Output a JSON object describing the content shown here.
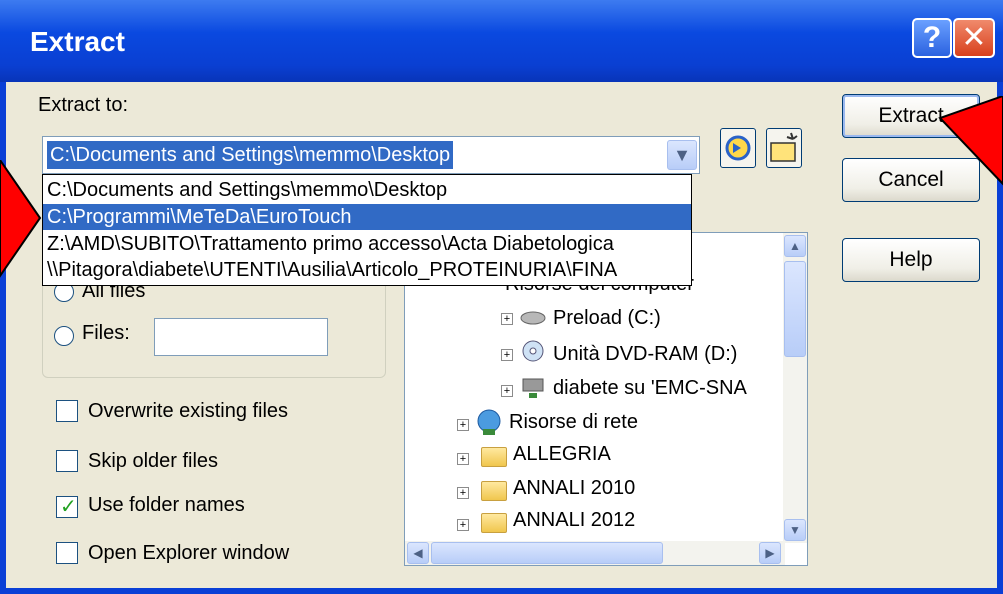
{
  "window": {
    "title": "Extract",
    "help_glyph": "?",
    "close_glyph": "✕"
  },
  "extract_to": {
    "label": "Extract to:",
    "value": "C:\\Documents and Settings\\memmo\\Desktop",
    "options": [
      "C:\\Documents and Settings\\memmo\\Desktop",
      "C:\\Programmi\\MeTeDa\\EuroTouch",
      "Z:\\AMD\\SUBITO\\Trattamento primo accesso\\Acta Diabetologica",
      "\\\\Pitagora\\diabete\\UTENTI\\Ausilia\\Articolo_PROTEINURIA\\FINA"
    ],
    "selected_index": 1
  },
  "buttons": {
    "extract": "Extract",
    "cancel": "Cancel",
    "help": "Help"
  },
  "files_group": {
    "all_files_label": "All files",
    "files_label": "Files:",
    "files_value": ""
  },
  "checkboxes": [
    {
      "label": "Overwrite existing files",
      "checked": false
    },
    {
      "label": "Skip older files",
      "checked": false
    },
    {
      "label": "Use folder names",
      "checked": true
    },
    {
      "label": "Open Explorer window",
      "checked": false
    }
  ],
  "tree": {
    "items": [
      {
        "label": "Risorse del computer"
      },
      {
        "label": "Preload (C:)"
      },
      {
        "label": "Unità DVD-RAM (D:)"
      },
      {
        "label": "diabete su 'EMC-SNA"
      },
      {
        "label": "Risorse di rete"
      },
      {
        "label": "ALLEGRIA"
      },
      {
        "label": "ANNALI 2010"
      },
      {
        "label": "ANNALI 2012"
      }
    ]
  },
  "colors": {
    "titlebar": "#0a49e0",
    "selection": "#316ac5",
    "annotation_arrow": "#ff0000"
  }
}
